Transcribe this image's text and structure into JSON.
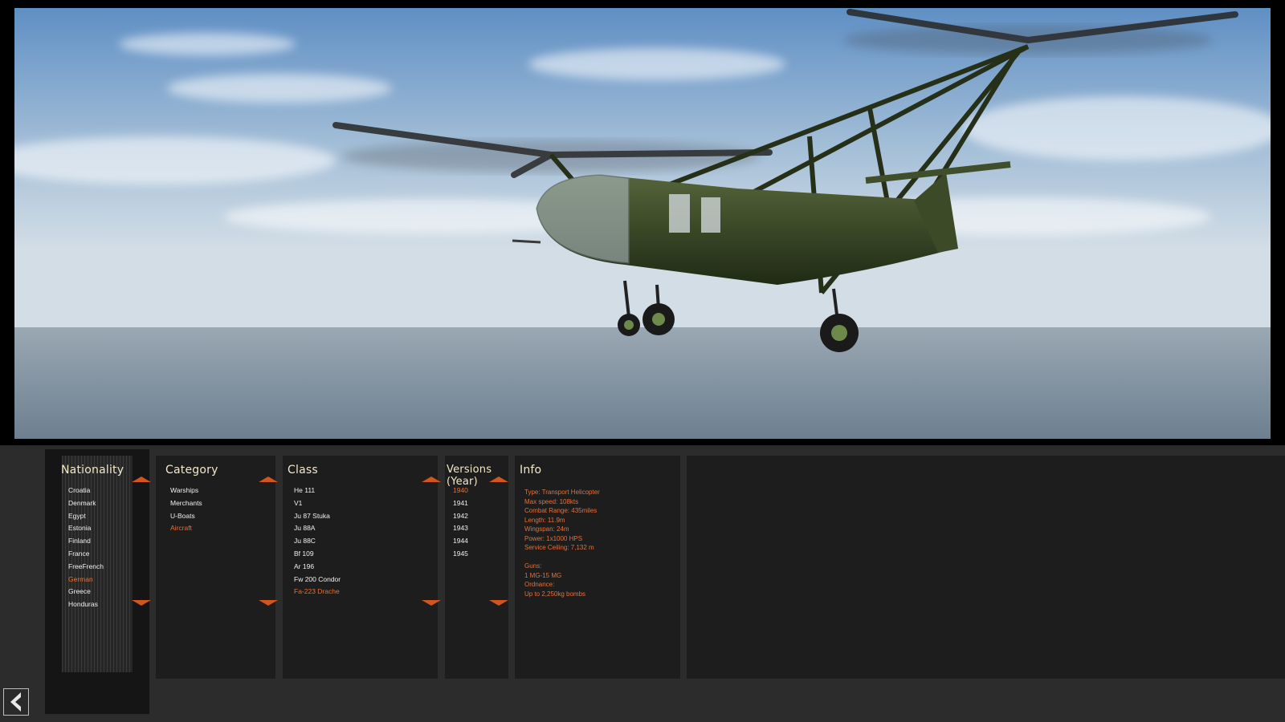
{
  "nationality": {
    "title": "Nationality",
    "items": [
      "Croatia",
      "Denmark",
      "Egypt",
      "Estonia",
      "Finland",
      "France",
      "FreeFrench",
      "German",
      "Greece",
      "Honduras"
    ],
    "selected": "German"
  },
  "category": {
    "title": "Category",
    "items": [
      "Warships",
      "Merchants",
      "U-Boats",
      "Aircraft"
    ],
    "selected": "Aircraft"
  },
  "class": {
    "title": "Class",
    "items": [
      "He 111",
      "V1",
      "Ju 87 Stuka",
      "Ju 88A",
      "Ju 88C",
      "Bf 109",
      "Ar 196",
      "Fw 200 Condor",
      "Fa-223 Drache"
    ],
    "selected": "Fa-223 Drache"
  },
  "versions": {
    "title": "Versions (Year)",
    "items": [
      "1940",
      "1941",
      "1942",
      "1943",
      "1944",
      "1945"
    ],
    "selected": "1940"
  },
  "info": {
    "title": "Info",
    "lines": [
      "Type: Transport Helicopter",
      "Max speed: 108kts",
      "Combat Range: 435miles",
      "Length: 11.9m",
      "Wingspan: 24m",
      "Power: 1x1000 HPS",
      "Service Ceiling: 7,132 m",
      "",
      "Guns:",
      "1 MG-15 MG",
      "Ordnance:",
      "Up to 2,250kg bombs"
    ]
  },
  "icons": {
    "scroll_up": "triangle-up-icon",
    "scroll_down": "triangle-down-icon",
    "back": "chevron-left-icon"
  },
  "colors": {
    "accent": "#e2713c",
    "arrow": "#d2551f",
    "panel_bg": "#1d1d1d",
    "title": "#f3e8c8"
  }
}
